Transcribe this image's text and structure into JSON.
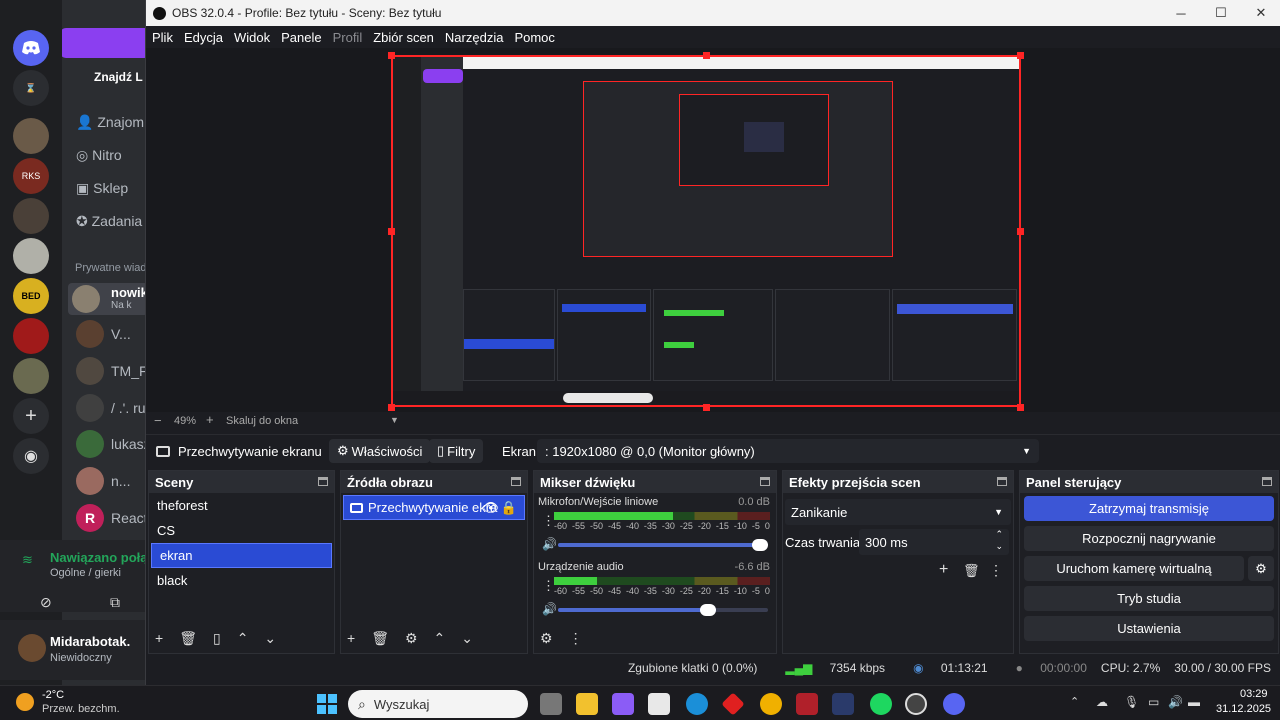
{
  "discord": {
    "nav": [
      "Znajdź L",
      "Znajom",
      "Nitro",
      "Sklep",
      "Zadania"
    ],
    "dm_header": "Prywatne wiad",
    "dms": [
      {
        "name": "nowik",
        "sub": "Na k"
      },
      {
        "name": "V..."
      },
      {
        "name": "TM_F"
      },
      {
        "name": "/ .'. ru"
      },
      {
        "name": "lukasz"
      },
      {
        "name": "n..."
      },
      {
        "name": "React"
      }
    ],
    "voice": {
      "status": "Nawiązano połą",
      "channel": "Ogólne / gierki"
    },
    "user": {
      "name": "Midarabotak.",
      "status": "Niewidoczny"
    }
  },
  "obs": {
    "title": "OBS 32.0.4 - Profile: Bez tytułu - Sceny: Bez tytułu",
    "menu": [
      "Plik",
      "Edycja",
      "Widok",
      "Panele",
      "Profil",
      "Zbiór scen",
      "Narzędzia",
      "Pomoc"
    ],
    "zoom": {
      "minus": "−",
      "value": "49%",
      "plus": "+",
      "mode": "Skaluj do okna"
    },
    "source_toolbar": {
      "source": "Przechwytywanie ekranu",
      "properties": "Właściwości",
      "filters": "Filtry",
      "screen_label": "Ekran",
      "screen_value": ": 1920x1080 @ 0,0 (Monitor główny)"
    },
    "scenes": {
      "title": "Sceny",
      "items": [
        "theforest",
        "CS",
        "ekran",
        "black"
      ],
      "selected": "ekran"
    },
    "sources": {
      "title": "Źródła obrazu",
      "items": [
        "Przechwytywanie ekra"
      ]
    },
    "mixer": {
      "title": "Mikser dźwięku",
      "scale": [
        "-60",
        "-55",
        "-50",
        "-45",
        "-40",
        "-35",
        "-30",
        "-25",
        "-20",
        "-15",
        "-10",
        "-5",
        "0"
      ],
      "channels": [
        {
          "name": "Mikrofon/Wejście liniowe",
          "db": "0.0 dB",
          "level": 0.55,
          "volume": 1.0
        },
        {
          "name": "Urządzenie audio",
          "db": "-6.6 dB",
          "level": 0.2,
          "volume": 0.75
        }
      ]
    },
    "transitions": {
      "title": "Efekty przejścia scen",
      "effect": "Zanikanie",
      "duration_label": "Czas trwania",
      "duration_value": "300 ms"
    },
    "controls": {
      "title": "Panel sterujący",
      "buttons": [
        "Zatrzymaj transmisję",
        "Rozpocznij nagrywanie",
        "Uruchom kamerę wirtualną",
        "Tryb studia",
        "Ustawienia"
      ]
    },
    "status": {
      "dropped": "Zgubione klatki 0 (0.0%)",
      "bitrate": "7354 kbps",
      "live_time": "01:13:21",
      "rec_time": "00:00:00",
      "cpu": "CPU: 2.7%",
      "fps": "30.00 / 30.00 FPS"
    }
  },
  "taskbar": {
    "weather_temp": "-2°C",
    "weather_desc": "Przew. bezchm.",
    "search_placeholder": "Wyszukaj",
    "time": "03:29",
    "date": "31.12.2025"
  },
  "colors": {
    "accent": "#3c56d6",
    "selection": "#2a4bd4",
    "record": "#ff2525",
    "meter_green": "#3ecf3e",
    "discord_purple": "#8b3ff0"
  }
}
